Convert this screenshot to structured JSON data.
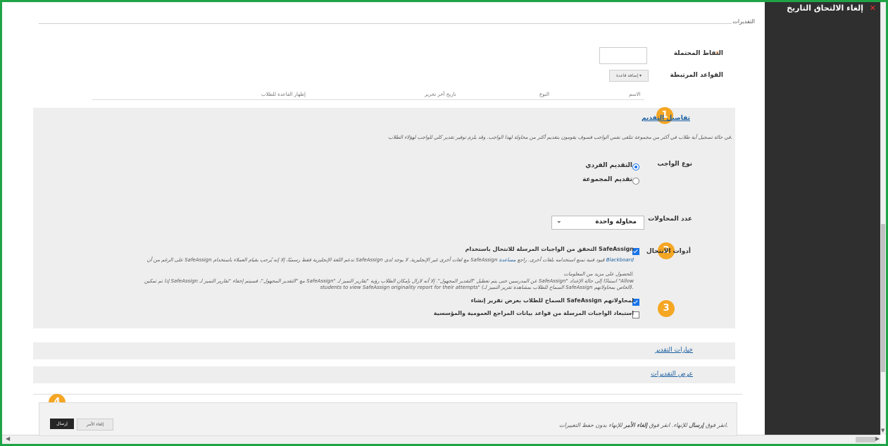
{
  "top_panel": {
    "title": "إلغاء الالتحاق التاريخ",
    "close": "✕"
  },
  "grading": {
    "section_title": "التقديرات",
    "points_label": "النقاط المحتملة",
    "required_mark": "*",
    "points_value": "",
    "rubrics_label": "القواعد المرتبطة",
    "add_rubric_button": "إضافة قاعدة",
    "rubric_columns": [
      "الاسم",
      "النوع",
      "تاريخ آخر تحرير",
      "إظهار القاعدة للطلاب"
    ]
  },
  "submission": {
    "title": "تفاصيل التقديم",
    "notice": "في حالة تسجيل أية طلاب في أكثر من مجموعة تتلقى نفس الواجب فسوف يقومون بتقديم أكثر من محاولة لهذا الواجب. وقد يلزم توفير تقدير كلي للواجب لهؤلاء الطلاب.",
    "type_label": "نوع الواجب",
    "type_options": [
      "التقديم الفردي",
      "تقديم المجموعة"
    ],
    "attempts_label": "عدد المحاولات",
    "attempts_value": "محاولة واحدة",
    "plagiarism_label": "أدوات الانتحال",
    "check_label": "التحقق من الواجبات المرسلة للانتحال باستخدام SafeAssign",
    "note_line1": "على الرغم من أن SafeAssign تدعم اللغة الإنجليزية فقط رسميًا، إلا إنه يُرحب بقيام العملاء باستخدام SafeAssign مع لغات أخرى غير الإنجليزية. لا يوجد لدى SafeAssign قيود فنية تمنع استخدامه بلغات أخرى. راجع",
    "note_link": "مساعدة Blackboard",
    "note_line2": "للحصول على مزيد من المعلومات.",
    "note_line3": "إذا تم تمكين SafeAssign مع \"التقدير المجهول\"، فسيتم إخفاء \"تقارير التميز لـ SafeAssign\" عن المدرسين حتى يتم تعطيل \"التقدير المجهول\". إلا أنه لازال بإمكان الطلاب رؤية \"تقارير التميز لـ SafeAssign\" استنادًا إلى حالة الإعداد \"Allow",
    "note_line4": "students to view SafeAssign originality report for their attempts\" (السماح للطلاب بمشاهدة تقرير التميز لـ SafeAssign الخاص بمحاولاتهم).",
    "allow_view_label": "السماح للطلاب بعرض تقرير إنشاء SafeAssign لمحاولاتهم",
    "exclude_label": "استبعاد الواجبات المرسلة من قواعد بيانات المراجع العمومية والمؤسسية"
  },
  "sections": {
    "grading_options": "خيارات التقدير",
    "display_grades": "عرض التقديرات"
  },
  "footer": {
    "instruction_pre": "انقر فوق ",
    "submit_word": "إرسال",
    "instruction_mid": " للإنهاء. انقر فوق ",
    "cancel_word": "إلغاء الأمر",
    "instruction_post": " للإنهاء بدون حفظ التغييرات.",
    "cancel_button": "إلغاء الأمر",
    "submit_button": "إرسال"
  },
  "badges": [
    "1",
    "2",
    "3",
    "4"
  ],
  "colors": {
    "accent": "#f5a623",
    "frame": "#1ea446",
    "link": "#1a5fa0"
  }
}
